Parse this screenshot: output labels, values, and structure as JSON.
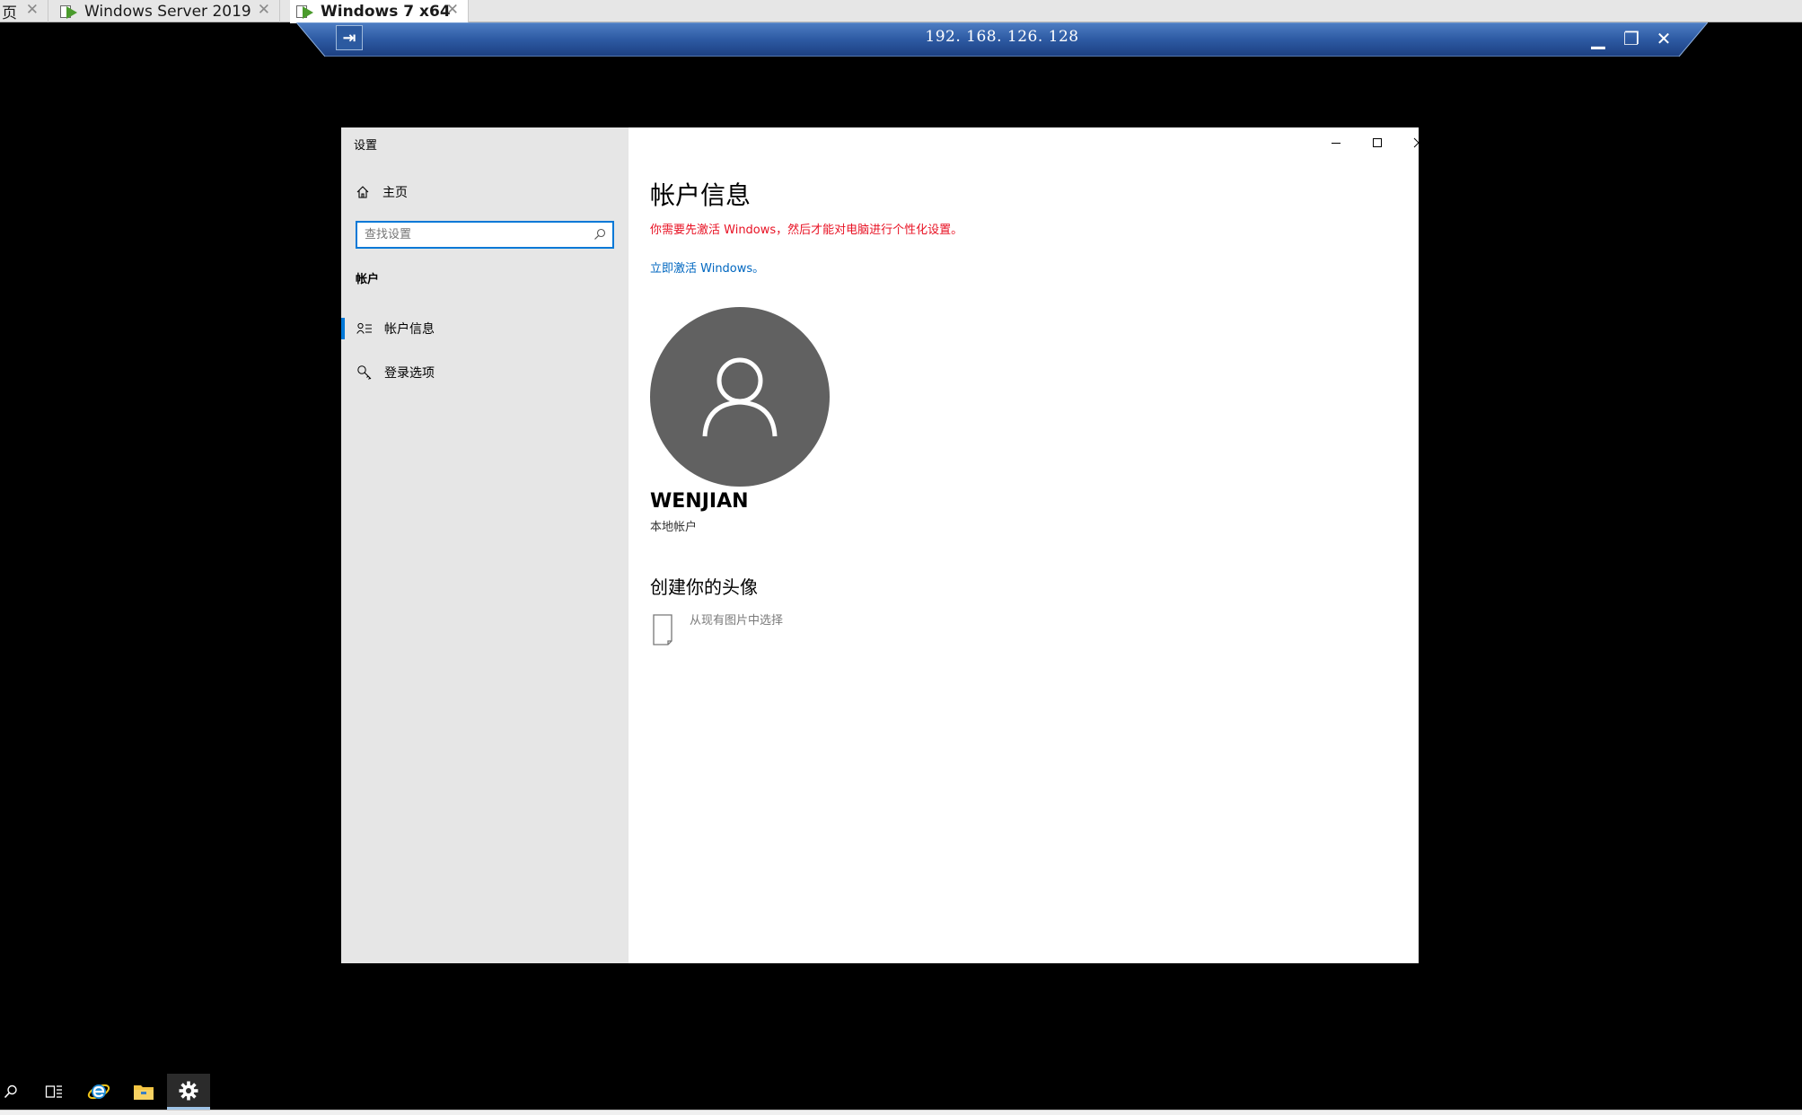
{
  "tabs": [
    {
      "label": "页",
      "active": false
    },
    {
      "label": "Windows Server 2019",
      "active": false
    },
    {
      "label": "Windows 7 x64",
      "active": true
    }
  ],
  "tab_close_glyph": "✕",
  "connection_bar": {
    "title": "192. 168. 126. 128",
    "pin_glyph": "⇥",
    "minimize_glyph": "▁",
    "restore_glyph": "❐",
    "close_glyph": "✕"
  },
  "settings_window": {
    "title": "设置",
    "sidebar": {
      "home_label": "主页",
      "search_placeholder": "查找设置",
      "section_label": "帐户",
      "items": [
        {
          "label": "帐户信息",
          "icon": "person-list-icon",
          "selected": true
        },
        {
          "label": "登录选项",
          "icon": "key-icon",
          "selected": false
        }
      ]
    },
    "content": {
      "page_title": "帐户信息",
      "activation_warning": "你需要先激活 Windows，然后才能对电脑进行个性化设置。",
      "activate_link": "立即激活 Windows。",
      "username": "WENJIAN",
      "account_type": "本地帐户",
      "create_avatar_title": "创建你的头像",
      "pick_existing_label": "从现有图片中选择"
    }
  },
  "taskbar": {
    "items": [
      "search-icon",
      "task-view-icon",
      "internet-explorer-icon",
      "file-explorer-icon",
      "settings-gear-icon"
    ],
    "active_item": "settings-gear-icon"
  },
  "colors": {
    "accent": "#0078d7",
    "warning": "#e81123",
    "link": "#0067c0",
    "avatar_bg": "#616161",
    "sidebar_bg": "#e6e6e6"
  }
}
